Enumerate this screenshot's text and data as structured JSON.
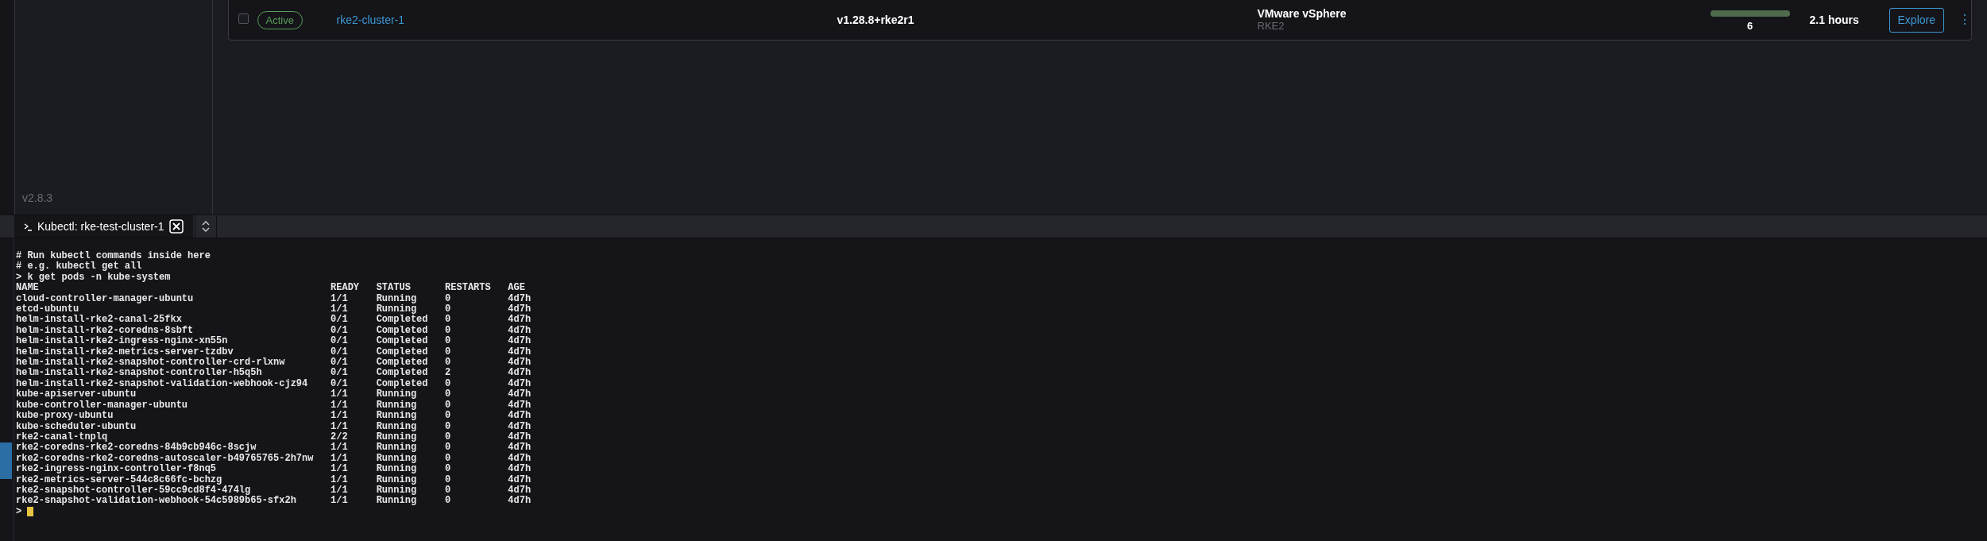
{
  "cluster_row": {
    "checked": false,
    "state": "Active",
    "name": "rke2-cluster-1",
    "version": "v1.28.8+rke2r1",
    "provider": "VMware vSphere",
    "distro": "RKE2",
    "machines": {
      "level": 1,
      "count": "6"
    },
    "age": "2.1 hours",
    "action": "Explore",
    "menu": "⋮"
  },
  "sidebar": {
    "version": "v2.8.3"
  },
  "tabs": [
    {
      "label": "Kubectl: rke-test-cluster-1",
      "selected": true
    }
  ],
  "terminal": {
    "lines": [
      "# Run kubectl commands inside here",
      "# e.g. kubectl get all",
      "> k get pods -n kube-system"
    ],
    "columns": [
      "NAME",
      "READY",
      "STATUS",
      "RESTARTS",
      "AGE"
    ],
    "rows": [
      [
        "cloud-controller-manager-ubuntu",
        "1/1",
        "Running",
        "0",
        "4d7h"
      ],
      [
        "etcd-ubuntu",
        "1/1",
        "Running",
        "0",
        "4d7h"
      ],
      [
        "helm-install-rke2-canal-25fkx",
        "0/1",
        "Completed",
        "0",
        "4d7h"
      ],
      [
        "helm-install-rke2-coredns-8sbft",
        "0/1",
        "Completed",
        "0",
        "4d7h"
      ],
      [
        "helm-install-rke2-ingress-nginx-xn55n",
        "0/1",
        "Completed",
        "0",
        "4d7h"
      ],
      [
        "helm-install-rke2-metrics-server-tzdbv",
        "0/1",
        "Completed",
        "0",
        "4d7h"
      ],
      [
        "helm-install-rke2-snapshot-controller-crd-rlxnw",
        "0/1",
        "Completed",
        "0",
        "4d7h"
      ],
      [
        "helm-install-rke2-snapshot-controller-h5q5h",
        "0/1",
        "Completed",
        "2",
        "4d7h"
      ],
      [
        "helm-install-rke2-snapshot-validation-webhook-cjz94",
        "0/1",
        "Completed",
        "0",
        "4d7h"
      ],
      [
        "kube-apiserver-ubuntu",
        "1/1",
        "Running",
        "0",
        "4d7h"
      ],
      [
        "kube-controller-manager-ubuntu",
        "1/1",
        "Running",
        "0",
        "4d7h"
      ],
      [
        "kube-proxy-ubuntu",
        "1/1",
        "Running",
        "0",
        "4d7h"
      ],
      [
        "kube-scheduler-ubuntu",
        "1/1",
        "Running",
        "0",
        "4d7h"
      ],
      [
        "rke2-canal-tnplq",
        "2/2",
        "Running",
        "0",
        "4d7h"
      ],
      [
        "rke2-coredns-rke2-coredns-84b9cb946c-8scjw",
        "1/1",
        "Running",
        "0",
        "4d7h"
      ],
      [
        "rke2-coredns-rke2-coredns-autoscaler-b49765765-2h7nw",
        "1/1",
        "Running",
        "0",
        "4d7h"
      ],
      [
        "rke2-ingress-nginx-controller-f8nq5",
        "1/1",
        "Running",
        "0",
        "4d7h"
      ],
      [
        "rke2-metrics-server-544c8c66fc-bchzg",
        "1/1",
        "Running",
        "0",
        "4d7h"
      ],
      [
        "rke2-snapshot-controller-59cc9cd8f4-474lg",
        "1/1",
        "Running",
        "0",
        "4d7h"
      ],
      [
        "rke2-snapshot-validation-webhook-54c5989b65-sfx2h",
        "1/1",
        "Running",
        "0",
        "4d7h"
      ]
    ],
    "prompt": ">"
  }
}
